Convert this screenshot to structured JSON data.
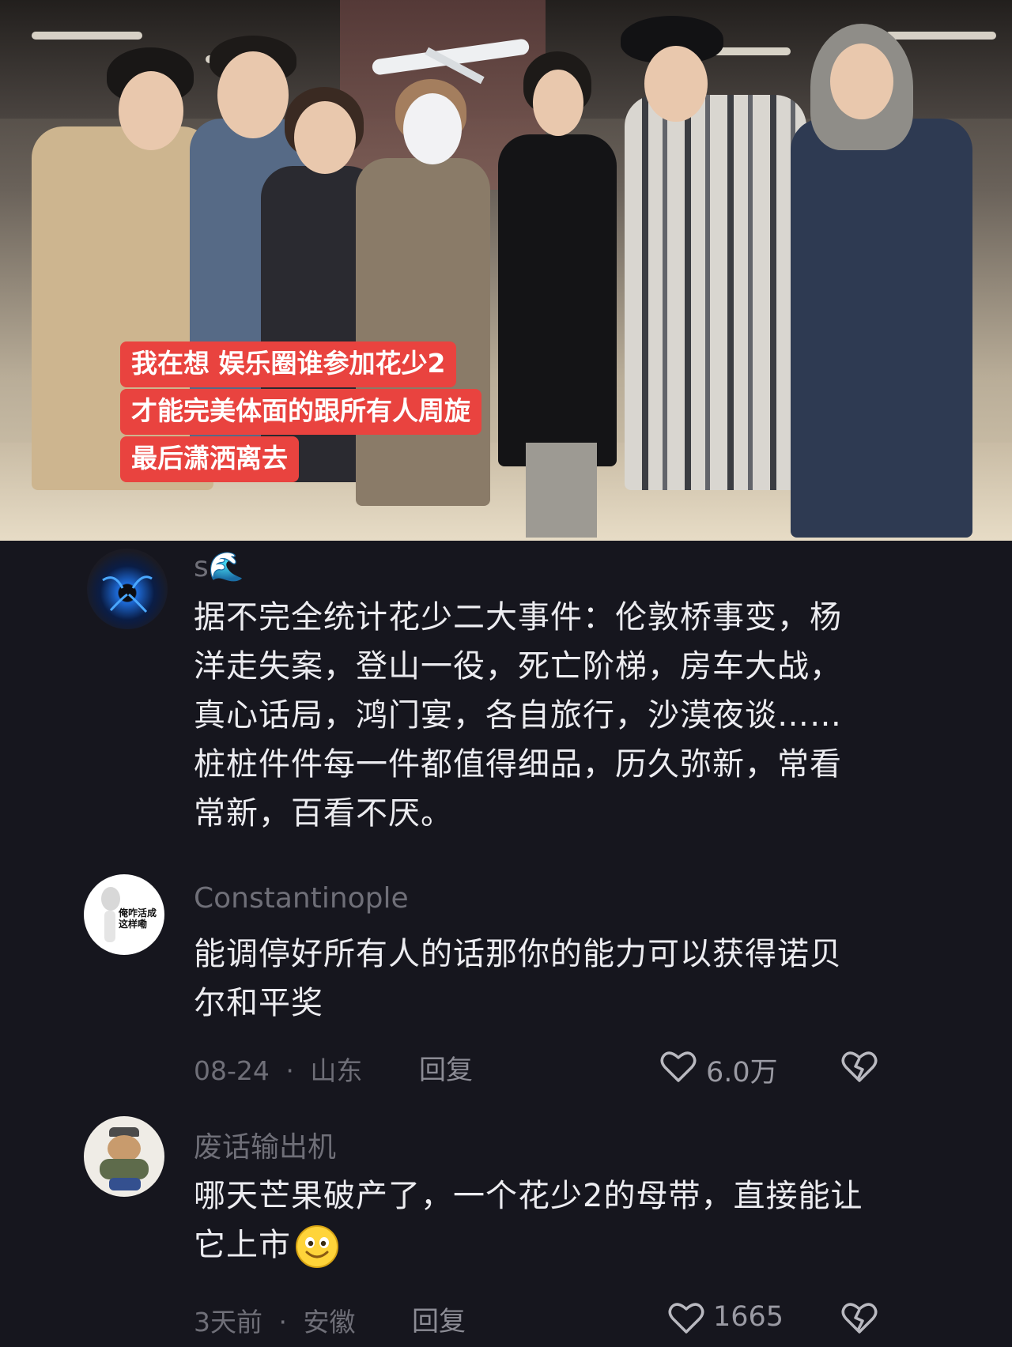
{
  "post": {
    "caption_lines": [
      "我在想 娱乐圈谁参加花少2",
      "才能完美体面的跟所有人周旋",
      "最后潇洒离去"
    ]
  },
  "comments": [
    {
      "username": "s🌊",
      "avatar": "glowing-blue-avatar",
      "text": "据不完全统计花少二大事件：伦敦桥事变，杨洋走失案，登山一役，死亡阶梯，房车大战，真心话局，鸿门宴，各自旅行，沙漠夜谈……桩桩件件每一件都值得细品，历久弥新，常看常新，百看不厌。"
    },
    {
      "username": "Constantinople",
      "avatar": "meme-sticker-avatar",
      "avatar_text": "俺咋活成这样嘞",
      "text": "能调停好所有人的话那你的能力可以获得诺贝尔和平奖",
      "date": "08-24",
      "location": "山东",
      "reply_label": "回复",
      "likes": "6.0万"
    },
    {
      "username": "废话输出机",
      "avatar": "cartoon-cat-avatar",
      "text": "哪天芒果破产了，一个花少2的母带，直接能让它上市",
      "emoji": "grinning-face-emoji",
      "date": "3天前",
      "location": "安徽",
      "reply_label": "回复",
      "likes": "1665"
    }
  ],
  "meta_separator": "·",
  "colors": {
    "background": "#16161e",
    "caption_bg": "#e9433f",
    "muted_text": "#6f6f78",
    "body_text": "#ececf0"
  }
}
